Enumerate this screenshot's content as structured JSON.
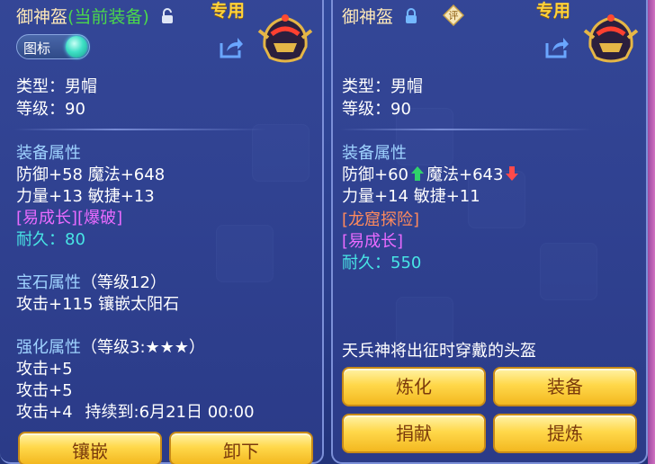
{
  "left": {
    "title": "御神盔",
    "title_status": "(当前装备)",
    "exclusive": "专用",
    "toggle_label": "图标",
    "type": "类型：男帽",
    "level": "等级：90",
    "attr_header": "装备属性",
    "attr_line1": "防御+58 魔法+648",
    "attr_line2": "力量+13 敏捷+13",
    "special": "[易成长][爆破]",
    "durability_label": "耐久：",
    "durability_value": "80",
    "gem_header": "宝石属性",
    "gem_level": "（等级12）",
    "gem_line": "攻击+115 镶嵌太阳石",
    "enhance_header": "强化属性",
    "enhance_level": "（等级3:★★★）",
    "enhance_line1": "攻击+5",
    "enhance_line2": "攻击+5",
    "enhance_line3_a": "攻击+4",
    "enhance_line3_b": "持续到:6月21日 00:00",
    "btn_inlay": "镶嵌",
    "btn_unequip": "卸下"
  },
  "right": {
    "title": "御神盔",
    "rating_badge": "评",
    "exclusive": "专用",
    "type": "类型：男帽",
    "level": "等级：90",
    "attr_header": "装备属性",
    "attr_def": "防御+60",
    "attr_mag": "魔法+643",
    "attr_line2": "力量+14 敏捷+11",
    "special1": "[龙窟探险]",
    "special2": "[易成长]",
    "durability_label": "耐久：",
    "durability_value": "550",
    "description": "天兵神将出征时穿戴的头盔",
    "btn_refine": "炼化",
    "btn_equip": "装备",
    "btn_donate": "捐献",
    "btn_extract": "提炼"
  },
  "icons": {
    "lock_left": "lock-open-icon",
    "lock_right": "lock-closed-icon",
    "share": "share-icon",
    "helmet": "helmet-icon",
    "up_arrow": "arrow-up-icon",
    "down_arrow": "arrow-down-icon"
  },
  "colors": {
    "green_up": "#2fd36a",
    "red_down": "#ff4a4a",
    "button_gold": "#ffd84a",
    "teal_value": "#48e5e5",
    "magenta_tag": "#e96bff",
    "orange_tag": "#ff8a5c"
  }
}
